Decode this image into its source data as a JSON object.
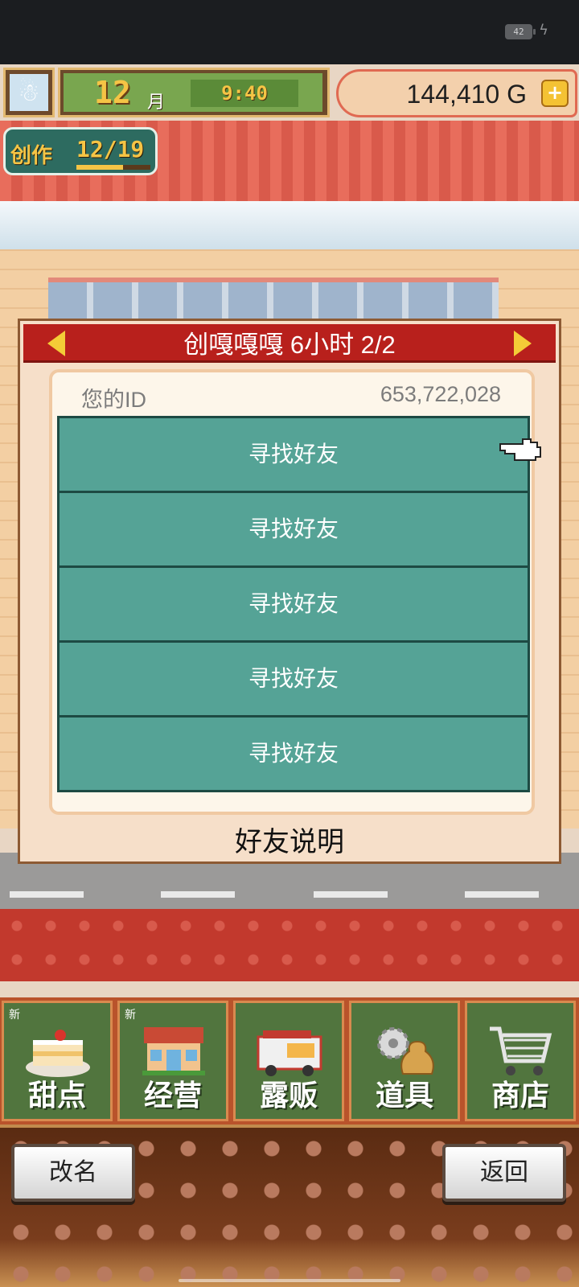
{
  "status_bar": {
    "battery": "42"
  },
  "hud": {
    "month_number": "12",
    "month_label": "月",
    "time": "9:40",
    "money": "144,410 G",
    "add_money_symbol": "+"
  },
  "create_badge": {
    "label": "创作",
    "progress_text": "12/19",
    "progress_fraction": 0.63
  },
  "dialog": {
    "title": "创嘎嘎嘎  6小时 2/2",
    "id_label": "您的ID",
    "id_value": "653,722,028",
    "find_friend_buttons": [
      "寻找好友",
      "寻找好友",
      "寻找好友",
      "寻找好友",
      "寻找好友"
    ],
    "footer_link": "好友说明"
  },
  "menu": {
    "items": [
      {
        "label": "甜点",
        "new_tag": "新",
        "icon": "cake-icon"
      },
      {
        "label": "经营",
        "new_tag": "新",
        "icon": "storefront-icon"
      },
      {
        "label": "露贩",
        "new_tag": "",
        "icon": "food-truck-icon"
      },
      {
        "label": "道具",
        "new_tag": "",
        "icon": "gear-bag-icon"
      },
      {
        "label": "商店",
        "new_tag": "",
        "icon": "shopping-cart-icon"
      }
    ]
  },
  "bottom": {
    "rename_label": "改名",
    "back_label": "返回"
  },
  "colors": {
    "dialog_header": "#b8201c",
    "friend_button": "#55a396",
    "menu_tile": "#51753e",
    "gold": "#f5c445"
  }
}
